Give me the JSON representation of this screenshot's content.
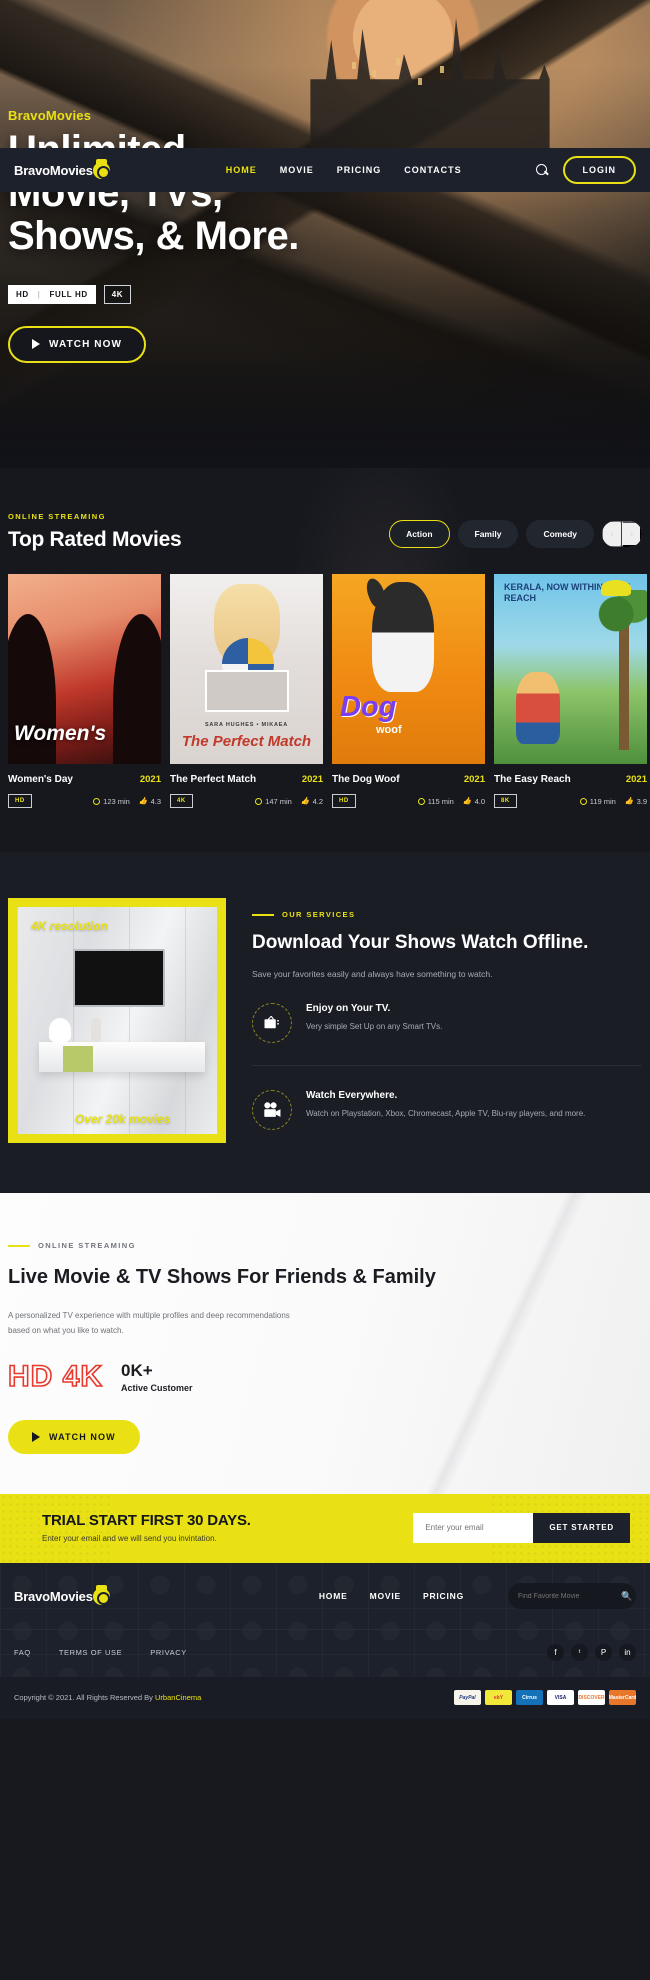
{
  "brand": {
    "name": "BravoMovies",
    "logo_icon": "film-reel-icon"
  },
  "nav": {
    "links": [
      {
        "label": "HOME",
        "active": true
      },
      {
        "label": "MOVIE",
        "active": false
      },
      {
        "label": "PRICING",
        "active": false
      },
      {
        "label": "CONTACTS",
        "active": false
      }
    ],
    "search_icon": "search-icon",
    "login_label": "LOGIN"
  },
  "hero": {
    "eyebrow": "BravoMovies",
    "title_line1": "Unlimited",
    "title_line2": "Movie, TVs,",
    "title_line3": "Shows, & More.",
    "badges": {
      "hd": "HD",
      "separator": "|",
      "fullhd": "FULL HD",
      "fourk": "4K"
    },
    "cta_label": "WATCH NOW",
    "cta_icon": "play-icon"
  },
  "top_rated": {
    "eyebrow": "ONLINE STREAMING",
    "title": "Top Rated Movies",
    "filters": [
      {
        "label": "Action",
        "active": true
      },
      {
        "label": "Family",
        "active": false
      },
      {
        "label": "Comedy",
        "active": false
      }
    ],
    "prev_icon": "chevron-left-icon",
    "next_icon": "chevron-right-icon",
    "prev_label": "‹",
    "next_label": "›",
    "movies": [
      {
        "title": "Women's Day",
        "year": "2021",
        "quality": "HD",
        "duration": "123 min",
        "rating": "4.3",
        "poster_text": "Women's"
      },
      {
        "title": "The Perfect Match",
        "year": "2021",
        "quality": "4K",
        "duration": "147 min",
        "rating": "4.2",
        "poster_text": "The Perfect Match",
        "poster_sub": "SARA HUGHES • MIKAEA"
      },
      {
        "title": "The Dog Woof",
        "year": "2021",
        "quality": "HD",
        "duration": "115 min",
        "rating": "4.0",
        "poster_text": "Dog",
        "poster_sub": "woof"
      },
      {
        "title": "The Easy Reach",
        "year": "2021",
        "quality": "8K",
        "duration": "119 min",
        "rating": "3.9",
        "poster_text": "KERALA, NOW WITHIN EASY REACH"
      }
    ]
  },
  "services": {
    "image": {
      "top_text": "4K resolution",
      "bottom_text": "Over 20k movies"
    },
    "eyebrow": "OUR SERVICES",
    "title": "Download Your Shows Watch Offline.",
    "subtitle": "Save your favorites easily and always have something to watch.",
    "items": [
      {
        "icon": "tv-icon",
        "heading": "Enjoy on Your TV.",
        "text": "Very simple Set Up on any Smart TVs."
      },
      {
        "icon": "movie-camera-icon",
        "heading": "Watch Everywhere.",
        "text": "Watch on Playstation, Xbox, Chromecast, Apple TV, Blu-ray players, and more."
      }
    ]
  },
  "live": {
    "eyebrow": "ONLINE STREAMING",
    "title": "Live Movie & TV Shows For Friends & Family",
    "paragraph": "A personalized TV experience with multiple profiles and deep recommendations based on what you like to watch.",
    "hd4k": "HD 4K",
    "stat_number": "0K+",
    "stat_label": "Active Customer",
    "cta_label": "WATCH NOW",
    "cta_icon": "play-icon"
  },
  "trial": {
    "heading": "TRIAL START FIRST 30 DAYS.",
    "subtext": "Enter your email and we will send you invintation.",
    "input_placeholder": "Enter your email",
    "input_value": "",
    "button_label": "GET STARTED"
  },
  "footer": {
    "brand": "BravoMovies",
    "nav": [
      {
        "label": "HOME"
      },
      {
        "label": "MOVIE"
      },
      {
        "label": "PRICING"
      }
    ],
    "search_placeholder": "Find Favorite Movie",
    "search_value": "",
    "search_icon": "search-icon",
    "links": [
      {
        "label": "FAQ"
      },
      {
        "label": "TERMS OF USE"
      },
      {
        "label": "PRIVACY"
      }
    ],
    "socials": [
      {
        "name": "facebook-icon",
        "glyph": "f"
      },
      {
        "name": "twitter-icon",
        "glyph": "ᵗ"
      },
      {
        "name": "pinterest-icon",
        "glyph": "P"
      },
      {
        "name": "linkedin-icon",
        "glyph": "in"
      }
    ],
    "copyright_prefix": "Copyright © 2021. All Rights Reserved By ",
    "copyright_brand": "UrbanCinema",
    "payments": [
      {
        "name": "paypal-icon",
        "label": "PayPal"
      },
      {
        "name": "ebay-icon",
        "label": "ebY"
      },
      {
        "name": "cirrus-icon",
        "label": "Cirrus"
      },
      {
        "name": "visa-icon",
        "label": "VISA"
      },
      {
        "name": "discover-icon",
        "label": "DISCOVER"
      },
      {
        "name": "mastercard-icon",
        "label": "MasterCard"
      }
    ]
  },
  "colors": {
    "accent_yellow": "#e9e113",
    "dark_bg": "#17191f",
    "nav_bg": "#1d212b",
    "red_outline": "#e8392c"
  }
}
